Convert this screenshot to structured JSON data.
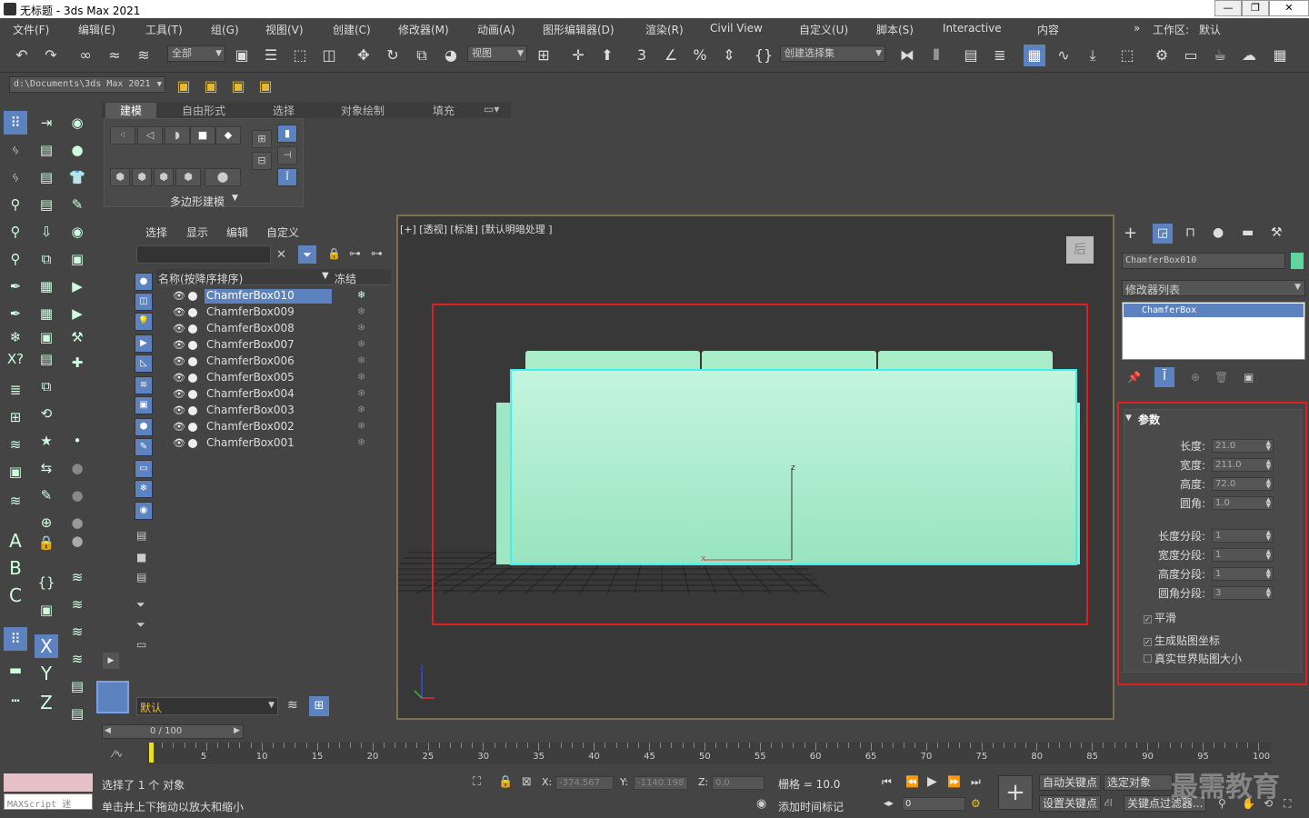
{
  "window": {
    "title": "无标题 - 3ds Max 2021",
    "buttons": [
      "—",
      "❐",
      "✕"
    ]
  },
  "menu": {
    "items": [
      "文件(F)",
      "编辑(E)",
      "工具(T)",
      "组(G)",
      "视图(V)",
      "创建(C)",
      "修改器(M)",
      "动画(A)",
      "图形编辑器(D)",
      "渲染(R)",
      "Civil View",
      "自定义(U)",
      "脚本(S)",
      "Interactive",
      "内容"
    ],
    "workspace_label": "工作区:",
    "workspace_value": "默认"
  },
  "toolbar": {
    "selection_filter": "全部",
    "ref_coord": "视图",
    "named_selection": "创建选择集"
  },
  "path": {
    "value": "d:\\Documents\\3ds Max 2021"
  },
  "ribbon": {
    "tabs": [
      "建模",
      "自由形式",
      "选择",
      "对象绘制",
      "填充"
    ],
    "panel_label": "多边形建模"
  },
  "scene_explorer": {
    "menu": [
      "选择",
      "显示",
      "编辑",
      "自定义"
    ],
    "col_name": "名称(按降序排序)",
    "col_freeze": "冻结",
    "rows": [
      {
        "name": "ChamferBox010",
        "selected": true
      },
      {
        "name": "ChamferBox009",
        "selected": false
      },
      {
        "name": "ChamferBox008",
        "selected": false
      },
      {
        "name": "ChamferBox007",
        "selected": false
      },
      {
        "name": "ChamferBox006",
        "selected": false
      },
      {
        "name": "ChamferBox005",
        "selected": false
      },
      {
        "name": "ChamferBox004",
        "selected": false
      },
      {
        "name": "ChamferBox003",
        "selected": false
      },
      {
        "name": "ChamferBox002",
        "selected": false
      },
      {
        "name": "ChamferBox001",
        "selected": false
      }
    ],
    "layer_value": "默认"
  },
  "viewport": {
    "label": "[+] [透视] [标准] [默认明暗处理 ]",
    "viewcube": "后",
    "object_color": "#a8ecc8",
    "highlight_color": "#e02020"
  },
  "command_panel": {
    "object_name": "ChamferBox010",
    "object_color": "#5fd6a0",
    "modifier_list": "修改器列表",
    "modifier_stack_item": "ChamferBox",
    "rollout_title": "参数",
    "params": [
      {
        "label": "长度:",
        "value": "21.0"
      },
      {
        "label": "宽度:",
        "value": "211.0"
      },
      {
        "label": "高度:",
        "value": "72.0"
      },
      {
        "label": "圆角:",
        "value": "1.0"
      }
    ],
    "segments": [
      {
        "label": "长度分段:",
        "value": "1"
      },
      {
        "label": "宽度分段:",
        "value": "1"
      },
      {
        "label": "高度分段:",
        "value": "1"
      },
      {
        "label": "圆角分段:",
        "value": "3"
      }
    ],
    "checks": [
      {
        "label": "平滑",
        "checked": true
      },
      {
        "label": "生成贴图坐标",
        "checked": true
      },
      {
        "label": "真实世界贴图大小",
        "checked": false
      }
    ]
  },
  "timeline": {
    "frame_display": "0 / 100",
    "ticks": [
      "5",
      "10",
      "15",
      "20",
      "25",
      "30",
      "35",
      "40",
      "45",
      "50",
      "55",
      "60",
      "65",
      "70",
      "75",
      "80",
      "85",
      "90",
      "95",
      "100"
    ]
  },
  "status": {
    "maxscript": "MAXScript 迷",
    "line1": "选择了 1 个 对象",
    "line2": "单击并上下拖动以放大和缩小",
    "x_label": "X:",
    "x_value": "-374.567",
    "y_label": "Y:",
    "y_value": "-1140.198",
    "z_label": "Z:",
    "z_value": "0.0",
    "grid": "栅格 = 10.0",
    "add_time_tag": "添加时间标记",
    "auto_key": "自动关键点",
    "selected_object": "选定对象",
    "set_key": "设置关键点",
    "key_filters": "关键点过滤器...",
    "frame_value": "0",
    "watermark": "最需教育"
  }
}
